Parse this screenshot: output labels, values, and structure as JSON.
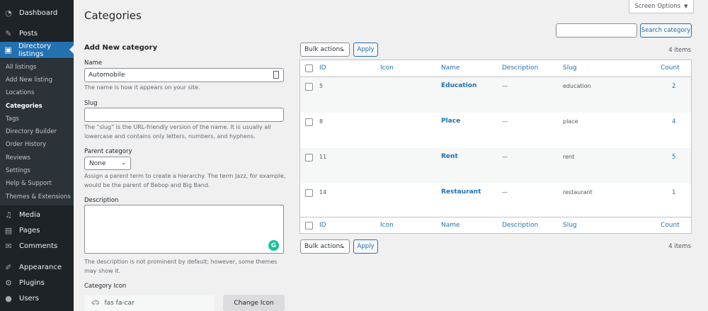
{
  "sidebar": {
    "dashboard": "Dashboard",
    "posts": "Posts",
    "directory_listings": "Directory listings",
    "submenu": [
      "All listings",
      "Add New listing",
      "Locations",
      "Categories",
      "Tags",
      "Directory Builder",
      "Order History",
      "Reviews",
      "Settings",
      "Help & Support",
      "Themes & Extensions"
    ],
    "media": "Media",
    "pages": "Pages",
    "comments": "Comments",
    "appearance": "Appearance",
    "plugins": "Plugins",
    "users": "Users"
  },
  "page_title": "Categories",
  "screen_options": "Screen Options",
  "search_button": "Search category",
  "form": {
    "heading": "Add New category",
    "name_label": "Name",
    "name_value": "Automobile",
    "name_desc": "The name is how it appears on your site.",
    "slug_label": "Slug",
    "slug_desc": "The “slug” is the URL-friendly version of the name. It is usually all lowercase and contains only letters, numbers, and hyphens.",
    "parent_label": "Parent category",
    "parent_value": "None",
    "parent_desc": "Assign a parent term to create a hierarchy. The term Jazz, for example, would be the parent of Bebop and Big Band.",
    "description_label": "Description",
    "description_desc": "The description is not prominent by default; however, some themes may show it.",
    "category_icon_label": "Category Icon",
    "icon_value": "fas fa-car",
    "change_icon": "Change Icon"
  },
  "bulk_actions": "Bulk actions",
  "apply": "Apply",
  "items_count": "4 items",
  "table": {
    "columns": [
      "ID",
      "Icon",
      "Name",
      "Description",
      "Slug",
      "Count"
    ],
    "rows": [
      {
        "id": "5",
        "name": "Education",
        "description": "—",
        "slug": "education",
        "count": "2"
      },
      {
        "id": "8",
        "name": "Place",
        "description": "—",
        "slug": "place",
        "count": "4"
      },
      {
        "id": "11",
        "name": "Rent",
        "description": "—",
        "slug": "rent",
        "count": "5"
      },
      {
        "id": "14",
        "name": "Restaurant",
        "description": "—",
        "slug": "restaurant",
        "count": "1"
      }
    ]
  },
  "colors": {
    "sidebar_bg": "#1d2327",
    "accent": "#2271b1",
    "page_bg": "#f0f0f1"
  },
  "icons": [
    "dashboard-icon",
    "pushpin-icon",
    "directory-icon",
    "media-icon",
    "pages-icon",
    "comments-icon",
    "appearance-icon",
    "plugins-icon",
    "users-icon",
    "car-icon",
    "grammarly-icon"
  ]
}
